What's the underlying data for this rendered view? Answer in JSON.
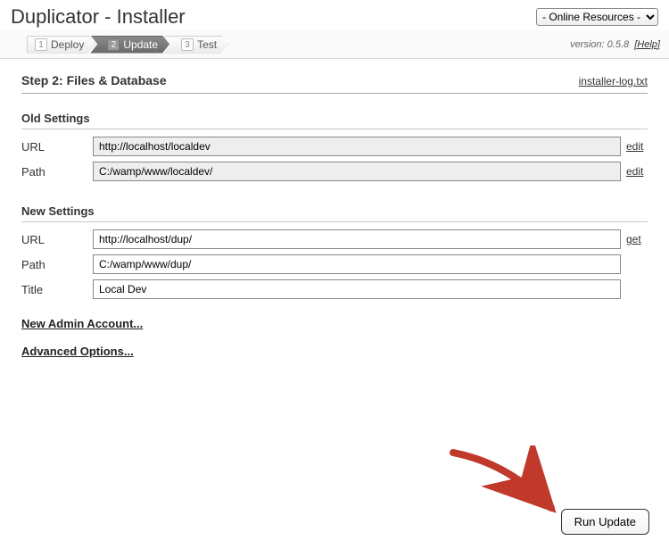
{
  "header": {
    "title": "Duplicator - Installer",
    "online_resources_label": "- Online Resources -"
  },
  "wizard": {
    "steps": [
      {
        "num": "1",
        "label": "Deploy"
      },
      {
        "num": "2",
        "label": "Update"
      },
      {
        "num": "3",
        "label": "Test"
      }
    ],
    "version_prefix": "version:",
    "version": "0.5.8",
    "help_label": "[Help]"
  },
  "step_header": {
    "title": "Step 2: Files & Database",
    "log_link": "installer-log.txt"
  },
  "old_settings": {
    "heading": "Old Settings",
    "url_label": "URL",
    "url_value": "http://localhost/localdev",
    "path_label": "Path",
    "path_value": "C:/wamp/www/localdev/",
    "edit_label": "edit"
  },
  "new_settings": {
    "heading": "New Settings",
    "url_label": "URL",
    "url_value": "http://localhost/dup/",
    "get_label": "get",
    "path_label": "Path",
    "path_value": "C:/wamp/www/dup/",
    "title_label": "Title",
    "title_value": "Local Dev"
  },
  "toggles": {
    "new_admin": "New Admin Account...",
    "advanced": "Advanced Options..."
  },
  "actions": {
    "run_update": "Run Update"
  }
}
